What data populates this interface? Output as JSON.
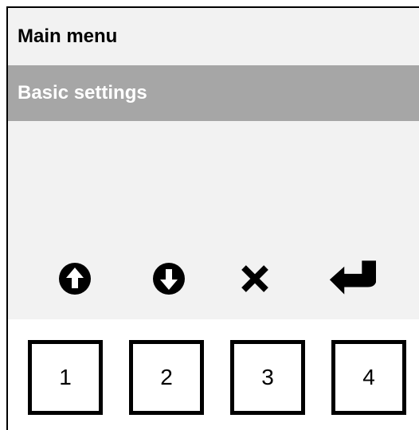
{
  "screen": {
    "title": "Main menu",
    "menu": {
      "selected_item": "Basic settings"
    },
    "softkeys": [
      {
        "icon": "arrow-up-circle-icon"
      },
      {
        "icon": "arrow-down-circle-icon"
      },
      {
        "icon": "close-icon"
      },
      {
        "icon": "enter-return-icon"
      }
    ]
  },
  "keypad": {
    "keys": [
      "1",
      "2",
      "3",
      "4"
    ]
  },
  "colors": {
    "screen_background": "#f2f2f2",
    "selection_bar": "#a6a6a6",
    "selection_text": "#ffffff",
    "text": "#000000"
  }
}
